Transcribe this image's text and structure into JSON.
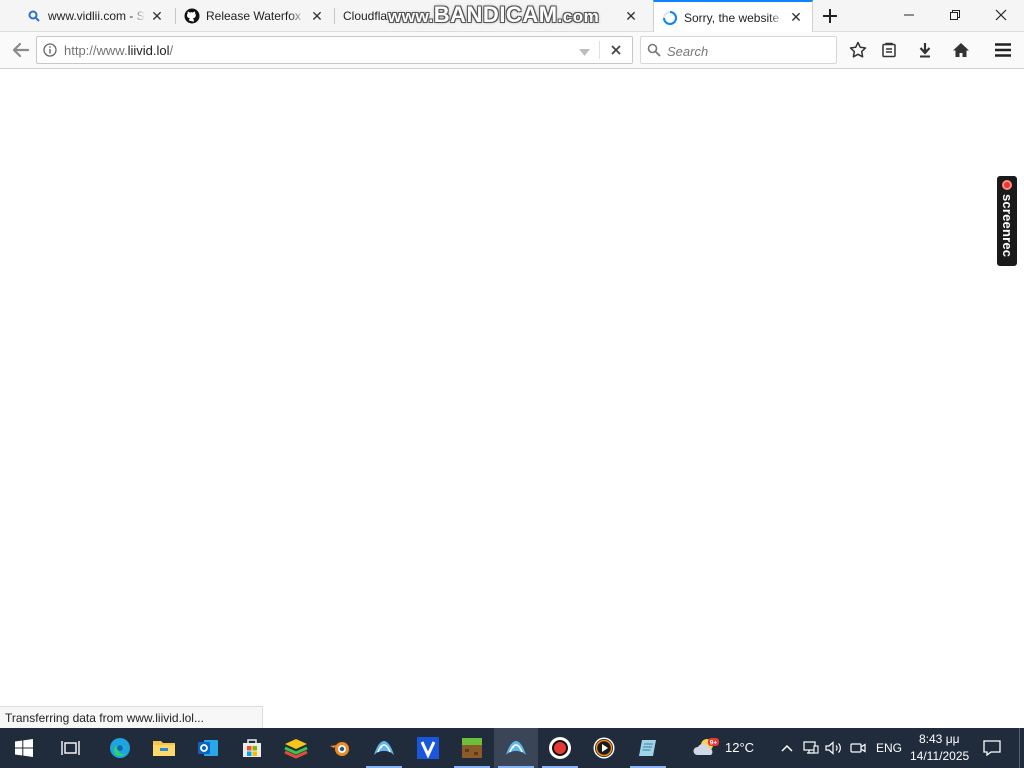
{
  "browser": {
    "tabs": [
      {
        "title": "www.vidlii.com - Search",
        "icon": "search-icon",
        "active": false
      },
      {
        "title": "Release Waterfox Classic",
        "icon": "github-icon",
        "active": false
      },
      {
        "title": "Cloudflare",
        "icon": "none",
        "active": false
      },
      {
        "title": "Sorry, the website",
        "icon": "loading-spinner-icon",
        "active": true
      }
    ],
    "watermark": {
      "prefix": "www.",
      "main": "BANDICAM",
      "suffix": ".com"
    },
    "address_bar": {
      "scheme": "http://www.",
      "host": "liivid.lol",
      "path": "/"
    },
    "search_bar": {
      "placeholder": "Search"
    },
    "status_text": "Transferring data from www.liivid.lol...",
    "overlay_badge": "screenrec"
  },
  "taskbar": {
    "apps": [
      "task-view-icon",
      "edge-icon",
      "file-explorer-icon",
      "outlook-icon",
      "microsoft-store-icon",
      "bluestacks-icon",
      "blender-icon",
      "waterfox-icon",
      "v-app-icon",
      "minecraft-icon",
      "waterfox-icon",
      "record-icon",
      "media-player-icon",
      "notepad-icon"
    ],
    "weather": {
      "temperature": "12°C",
      "badge": "9+"
    },
    "language": "ENG",
    "clock": {
      "time": "8:43 μμ",
      "date": "14/11/2025"
    }
  },
  "colors": {
    "accent": "#0a84ff",
    "taskbar": "#202c3c",
    "record_red": "#e53935"
  }
}
